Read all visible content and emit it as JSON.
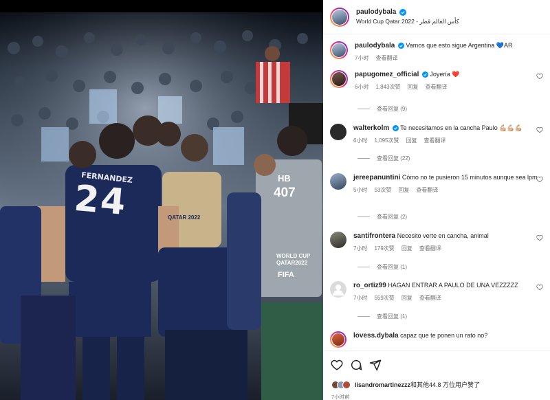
{
  "post": {
    "author": "paulodybala",
    "location": "World Cup Qatar 2022 - كأس العالم قطر",
    "likes_text": "lisandromartinezzz和其他44.8 万位用户赞了",
    "likes_user": "lisandromartinezzz",
    "likes_rest": "和其他44.8 万位用户赞了",
    "time_ago": "7小时前"
  },
  "comments": [
    {
      "user": "paulodybala",
      "verified": true,
      "text": "Vamos que esto sigue Argentina 💙AR",
      "time": "7小时",
      "likes": "",
      "reply": "",
      "translate": "查看翻译",
      "replies": ""
    },
    {
      "user": "papugomez_official",
      "verified": true,
      "text": "Joyería ❤️",
      "time": "6小时",
      "likes": "1,843次赞",
      "reply": "回复",
      "translate": "查看翻译",
      "replies": "查看回复 (9)"
    },
    {
      "user": "walterkolm",
      "verified": true,
      "text": "Te necesitamos en la cancha Paulo 💪🏼💪🏼💪🏼",
      "time": "6小时",
      "likes": "1,095次赞",
      "reply": "回复",
      "translate": "查看翻译",
      "replies": "查看回复 (22)"
    },
    {
      "user": "jereepanuntini",
      "verified": false,
      "text": "Cómo no te pusieron 15 minutos aunque sea lpm",
      "time": "5小时",
      "likes": "53次赞",
      "reply": "回复",
      "translate": "查看翻译",
      "replies": "查看回复 (2)"
    },
    {
      "user": "santifrontera",
      "verified": false,
      "text": "Necesito verte en cancha, animal",
      "time": "7小时",
      "likes": "179次赞",
      "reply": "回复",
      "translate": "查看翻译",
      "replies": "查看回复 (1)"
    },
    {
      "user": "ro_ortiz99",
      "verified": false,
      "text": "HAGAN ENTRAR A PAULO DE UNA VEZZZZZ",
      "time": "7小时",
      "likes": "559次赞",
      "reply": "回复",
      "translate": "查看翻译",
      "replies": "查看回复 (1)"
    },
    {
      "user": "lovess.dybala",
      "verified": false,
      "text": "capaz que te ponen un rato no?",
      "time": "7小时",
      "likes": "",
      "reply": "",
      "translate": "",
      "replies": ""
    }
  ],
  "photo": {
    "jersey_name": "FERNANDEZ",
    "jersey_number": "24",
    "bib_text": "HB",
    "bib_number": "407",
    "bib_sub1": "WORLD CUP",
    "bib_sub2": "QATAR2022",
    "bib_fifa": "FIFA",
    "shirt_text": "QATAR 2022"
  },
  "colors": {
    "verified": "#0095f6",
    "heart": "#ed4956",
    "argentina_blue": "#1c2a5a"
  }
}
